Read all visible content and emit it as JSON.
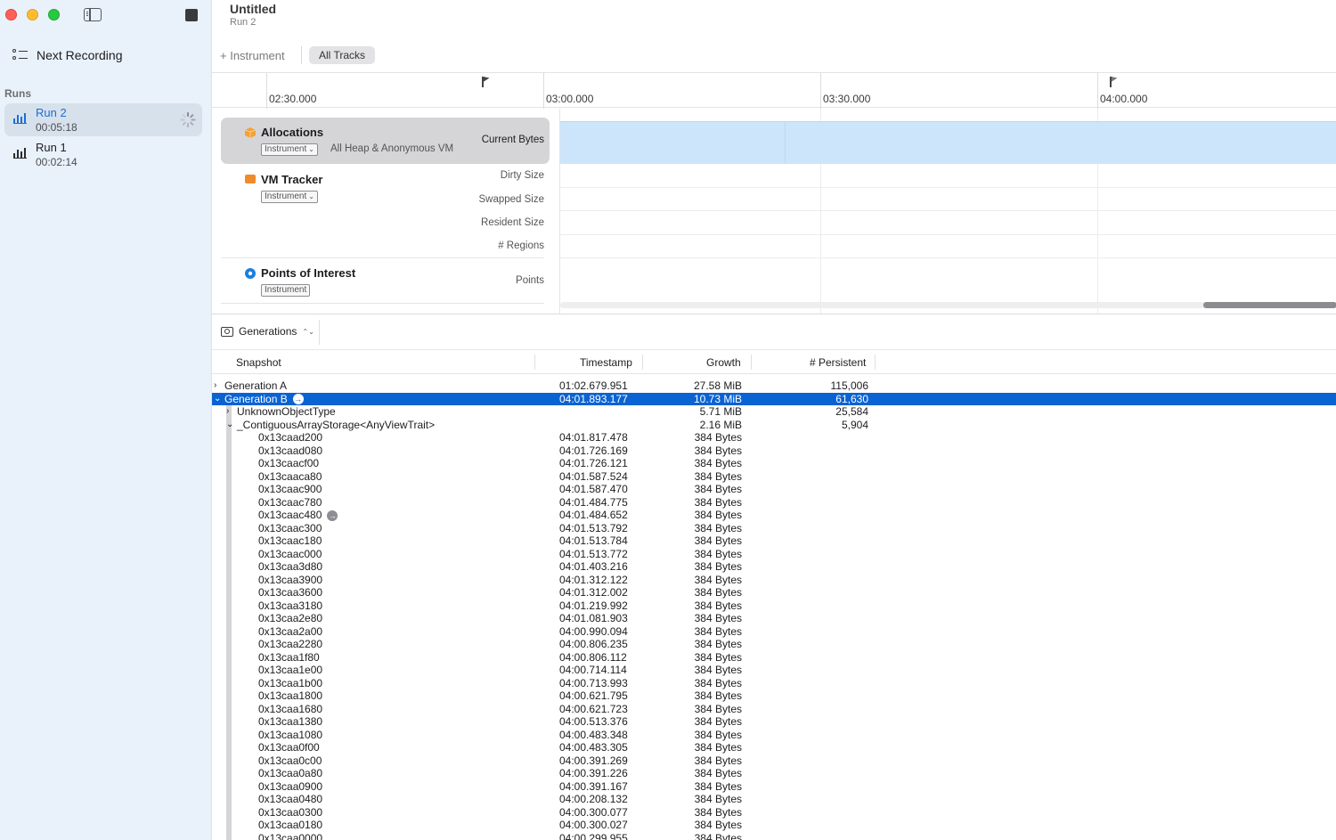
{
  "sidebar": {
    "next_recording": "Next Recording",
    "runs_label": "Runs",
    "runs": [
      {
        "name": "Run 2",
        "time": "00:05:18"
      },
      {
        "name": "Run 1",
        "time": "00:02:14"
      }
    ]
  },
  "document": {
    "title": "Untitled",
    "subtitle": "Run 2"
  },
  "toolbar": {
    "add_instrument": "+ Instrument",
    "all_tracks": "All Tracks"
  },
  "ruler": {
    "labels": [
      "02:30.000",
      "03:00.000",
      "03:30.000",
      "04:00.000"
    ]
  },
  "tracks": [
    {
      "name": "Allocations",
      "chip": "Instrument",
      "desc": "All Heap & Anonymous VM",
      "lanes": [
        "Current Bytes"
      ],
      "icon_color": "#f5a134"
    },
    {
      "name": "VM Tracker",
      "chip": "Instrument",
      "desc": "",
      "lanes": [
        "Dirty Size",
        "Swapped Size",
        "Resident Size",
        "# Regions"
      ],
      "icon_color": "#f08a2a"
    },
    {
      "name": "Points of Interest",
      "chip": "Instrument",
      "desc": "",
      "lanes": [
        "Points"
      ],
      "icon_color": "#1a7fe0"
    }
  ],
  "detail": {
    "mode_label": "Generations",
    "columns": {
      "snapshot": "Snapshot",
      "timestamp": "Timestamp",
      "growth": "Growth",
      "persistent": "# Persistent"
    }
  },
  "rows": [
    {
      "level": 0,
      "disc": "›",
      "name": "Generation A",
      "ts": "01:02.679.951",
      "growth": "27.58 MiB",
      "persistent": "115,006"
    },
    {
      "level": 0,
      "disc": "⌄",
      "name": "Generation B",
      "ts": "04:01.893.177",
      "growth": "10.73 MiB",
      "persistent": "61,630",
      "selected": true,
      "arrow": true
    },
    {
      "level": 1,
      "disc": "›",
      "name": "UnknownObjectType",
      "ts": "",
      "growth": "5.71 MiB",
      "persistent": "25,584"
    },
    {
      "level": 1,
      "disc": "⌄",
      "name": "_ContiguousArrayStorage<AnyViewTrait>",
      "ts": "",
      "growth": "2.16 MiB",
      "persistent": "5,904"
    },
    {
      "level": 2,
      "name": "0x13caad200",
      "ts": "04:01.817.478",
      "growth": "384 Bytes"
    },
    {
      "level": 2,
      "name": "0x13caad080",
      "ts": "04:01.726.169",
      "growth": "384 Bytes"
    },
    {
      "level": 2,
      "name": "0x13caacf00",
      "ts": "04:01.726.121",
      "growth": "384 Bytes"
    },
    {
      "level": 2,
      "name": "0x13caaca80",
      "ts": "04:01.587.524",
      "growth": "384 Bytes"
    },
    {
      "level": 2,
      "name": "0x13caac900",
      "ts": "04:01.587.470",
      "growth": "384 Bytes"
    },
    {
      "level": 2,
      "name": "0x13caac780",
      "ts": "04:01.484.775",
      "growth": "384 Bytes"
    },
    {
      "level": 2,
      "name": "0x13caac480",
      "ts": "04:01.484.652",
      "growth": "384 Bytes",
      "arrow_gray": true
    },
    {
      "level": 2,
      "name": "0x13caac300",
      "ts": "04:01.513.792",
      "growth": "384 Bytes"
    },
    {
      "level": 2,
      "name": "0x13caac180",
      "ts": "04:01.513.784",
      "growth": "384 Bytes"
    },
    {
      "level": 2,
      "name": "0x13caac000",
      "ts": "04:01.513.772",
      "growth": "384 Bytes"
    },
    {
      "level": 2,
      "name": "0x13caa3d80",
      "ts": "04:01.403.216",
      "growth": "384 Bytes"
    },
    {
      "level": 2,
      "name": "0x13caa3900",
      "ts": "04:01.312.122",
      "growth": "384 Bytes"
    },
    {
      "level": 2,
      "name": "0x13caa3600",
      "ts": "04:01.312.002",
      "growth": "384 Bytes"
    },
    {
      "level": 2,
      "name": "0x13caa3180",
      "ts": "04:01.219.992",
      "growth": "384 Bytes"
    },
    {
      "level": 2,
      "name": "0x13caa2e80",
      "ts": "04:01.081.903",
      "growth": "384 Bytes"
    },
    {
      "level": 2,
      "name": "0x13caa2a00",
      "ts": "04:00.990.094",
      "growth": "384 Bytes"
    },
    {
      "level": 2,
      "name": "0x13caa2280",
      "ts": "04:00.806.235",
      "growth": "384 Bytes"
    },
    {
      "level": 2,
      "name": "0x13caa1f80",
      "ts": "04:00.806.112",
      "growth": "384 Bytes"
    },
    {
      "level": 2,
      "name": "0x13caa1e00",
      "ts": "04:00.714.114",
      "growth": "384 Bytes"
    },
    {
      "level": 2,
      "name": "0x13caa1b00",
      "ts": "04:00.713.993",
      "growth": "384 Bytes"
    },
    {
      "level": 2,
      "name": "0x13caa1800",
      "ts": "04:00.621.795",
      "growth": "384 Bytes"
    },
    {
      "level": 2,
      "name": "0x13caa1680",
      "ts": "04:00.621.723",
      "growth": "384 Bytes"
    },
    {
      "level": 2,
      "name": "0x13caa1380",
      "ts": "04:00.513.376",
      "growth": "384 Bytes"
    },
    {
      "level": 2,
      "name": "0x13caa1080",
      "ts": "04:00.483.348",
      "growth": "384 Bytes"
    },
    {
      "level": 2,
      "name": "0x13caa0f00",
      "ts": "04:00.483.305",
      "growth": "384 Bytes"
    },
    {
      "level": 2,
      "name": "0x13caa0c00",
      "ts": "04:00.391.269",
      "growth": "384 Bytes"
    },
    {
      "level": 2,
      "name": "0x13caa0a80",
      "ts": "04:00.391.226",
      "growth": "384 Bytes"
    },
    {
      "level": 2,
      "name": "0x13caa0900",
      "ts": "04:00.391.167",
      "growth": "384 Bytes"
    },
    {
      "level": 2,
      "name": "0x13caa0480",
      "ts": "04:00.208.132",
      "growth": "384 Bytes"
    },
    {
      "level": 2,
      "name": "0x13caa0300",
      "ts": "04:00.300.077",
      "growth": "384 Bytes"
    },
    {
      "level": 2,
      "name": "0x13caa0180",
      "ts": "04:00.300.027",
      "growth": "384 Bytes"
    },
    {
      "level": 2,
      "name": "0x13caa0000",
      "ts": "04:00.299.955",
      "growth": "384 Bytes"
    }
  ]
}
